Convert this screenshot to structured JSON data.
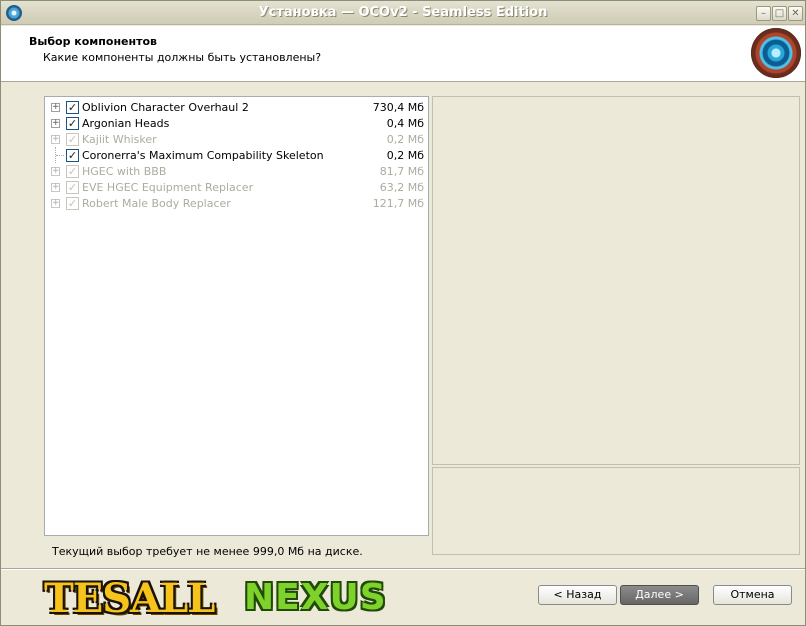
{
  "window": {
    "title": "Установка — OCOv2 - Seamless Edition"
  },
  "titlebar_buttons": {
    "minimize": "–",
    "maximize": "□",
    "close": "✕"
  },
  "header": {
    "title": "Выбор компонентов",
    "subtitle": "Какие компоненты должны быть установлены?"
  },
  "components": [
    {
      "name": "Oblivion Character Overhaul 2",
      "size": "730,4 Мб",
      "checked": true,
      "disabled": false,
      "expander": true
    },
    {
      "name": "Argonian Heads",
      "size": "0,4 Мб",
      "checked": true,
      "disabled": false,
      "expander": true
    },
    {
      "name": "Kajiit Whisker",
      "size": "0,2 Мб",
      "checked": true,
      "disabled": true,
      "expander": true
    },
    {
      "name": "Coronerra's Maximum Compability Skeleton",
      "size": "0,2 Мб",
      "checked": true,
      "disabled": false,
      "expander": false
    },
    {
      "name": "HGEC with BBB",
      "size": "81,7 Мб",
      "checked": true,
      "disabled": true,
      "expander": true
    },
    {
      "name": "EVE HGEC Equipment Replacer",
      "size": "63,2 Мб",
      "checked": true,
      "disabled": true,
      "expander": true
    },
    {
      "name": "Robert Male Body Replacer",
      "size": "121,7 Мб",
      "checked": true,
      "disabled": true,
      "expander": true
    }
  ],
  "disk_space_text": "Текущий выбор требует не менее 999,0 Мб на диске.",
  "logos": {
    "tesall": "TESALL",
    "nexus": "NEXUS"
  },
  "buttons": {
    "back": "< Назад",
    "next": "Далее >",
    "cancel": "Отмена"
  }
}
